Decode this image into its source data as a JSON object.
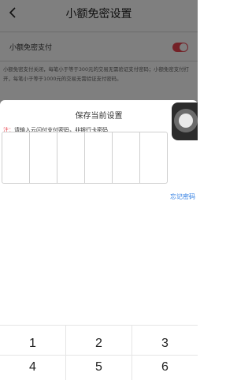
{
  "background_page": {
    "title": "小额免密设置",
    "row_label": "小额免密支付",
    "toggle_on": true,
    "accent_color": "#e8434e",
    "description": "小额免密支付关闭，每笔小于等于300元的交易无需验证支付密码；小额免密支付打开，每笔小于等于1000元的交易无需验证支付密码。"
  },
  "sheet": {
    "title": "保存当前设置",
    "note_prefix": "注：",
    "note_text": "请输入云闪付支付密码，非银行卡密码",
    "forgot_label": "忘记密码",
    "link_color": "#2a7ae2",
    "pin_length": 6
  },
  "keypad": {
    "keys": [
      "1",
      "2",
      "3",
      "4",
      "5",
      "6"
    ]
  }
}
